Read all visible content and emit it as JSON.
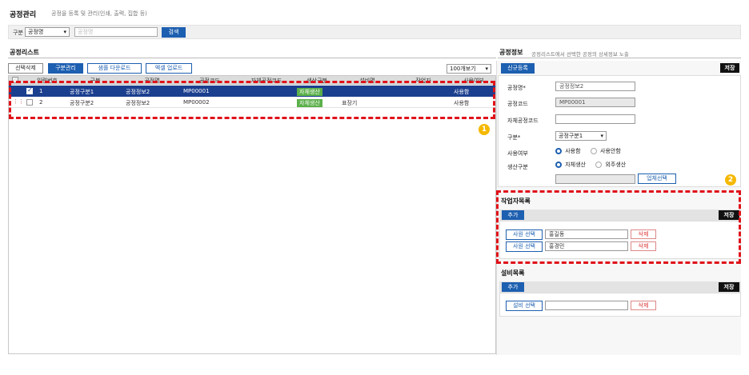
{
  "page": {
    "title": "공정관리",
    "subtitle": "공정을 등록 및 관리(인쇄, 출력, 집합 등)"
  },
  "filter": {
    "label": "구분",
    "select_value": "공정명",
    "input_placeholder": "공정명",
    "search_label": "검색"
  },
  "list": {
    "title": "공정리스트",
    "buttons": {
      "delete_selected": "선택삭제",
      "category_mgmt": "구분관리",
      "sample_download": "샘플 다운로드",
      "excel_upload": "엑셀 업로드"
    },
    "page_size": "100개보기",
    "columns": [
      "일련번호",
      "구분",
      "공정명",
      "공정코드",
      "자체공정코드",
      "생산구분",
      "설비명",
      "작업자",
      "사용여부"
    ],
    "rows": [
      {
        "no": "1",
        "category": "공정구분1",
        "name": "공정정보2",
        "code": "MP00001",
        "own_code": "",
        "production": "자체생산",
        "equipment": "",
        "worker": "",
        "use": "사용함"
      },
      {
        "no": "2",
        "category": "공정구분2",
        "name": "공정정보2",
        "code": "MP00002",
        "own_code": "",
        "production": "자체생산",
        "equipment": "표장기",
        "worker": "",
        "use": "사용함"
      }
    ]
  },
  "info": {
    "title": "공정정보",
    "subtitle": "공정리스트에서 선택한 공정의 상세정보 노출",
    "new_label": "신규등록",
    "save_label": "저장",
    "fields": {
      "name_label": "공정명*",
      "name_value": "공정정보2",
      "code_label": "공정코드",
      "code_value": "MP00001",
      "own_code_label": "자체공정코드",
      "own_code_value": "",
      "category_label": "구분*",
      "category_value": "공정구분1",
      "use_label": "사용여부",
      "use_yes": "사용함",
      "use_no": "사용안함",
      "production_label": "생산구분",
      "prod_self": "자체생산",
      "prod_outsource": "외주생산",
      "company_select": "업체선택"
    }
  },
  "workers": {
    "title": "작업자목록",
    "add_label": "추가",
    "save_label": "저장",
    "items": [
      {
        "select_label": "사원 선택",
        "name": "홍길동",
        "delete_label": "삭제"
      },
      {
        "select_label": "사원 선택",
        "name": "홍경민",
        "delete_label": "삭제"
      }
    ]
  },
  "equipment": {
    "title": "설비목록",
    "add_label": "추가",
    "save_label": "저장",
    "items": [
      {
        "select_label": "설비 선택",
        "name": "",
        "delete_label": "삭제"
      }
    ]
  },
  "annotations": {
    "badge1": "1",
    "badge2": "2"
  },
  "colors": {
    "accent": "#1d5fb0",
    "selected_row": "#1b3f8f",
    "tag_green": "#5bb04a",
    "highlight_red": "#e0121a",
    "badge_yellow": "#f5b800"
  }
}
